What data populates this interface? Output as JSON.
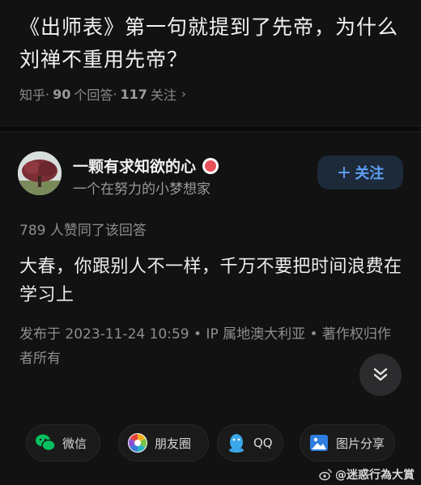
{
  "question": {
    "title": "《出师表》第一句就提到了先帝，为什么刘禅不重用先帝？",
    "source": "知乎",
    "answers_count": "90",
    "answers_label": "个回答",
    "followers_count": "117",
    "followers_label": "关注"
  },
  "author": {
    "name": "一颗有求知欲的心",
    "bio": "一个在努力的小梦想家",
    "follow_label": "关注",
    "follow_icon": "plus-icon",
    "badge_icon": "badge-icon"
  },
  "answer": {
    "upvotes_text": "789 人赞同了该回答",
    "content": "大春，你跟别人不一样，千万不要把时间浪费在学习上",
    "publish_info": "发布于 2023-11-24 10:59 • IP 属地澳大利亚 • 著作权归作者所有"
  },
  "share": {
    "wechat": "微信",
    "moments": "朋友圈",
    "qq": "QQ",
    "image": "图片分享"
  },
  "watermark": {
    "text": "@迷惑行為大賞",
    "icon": "weibo-icon"
  },
  "colors": {
    "background": "#121212",
    "accent_blue": "#5fa0f5",
    "follow_bg": "#1d2a3a",
    "wechat_green": "#07c160",
    "badge_red": "#e8505b"
  }
}
